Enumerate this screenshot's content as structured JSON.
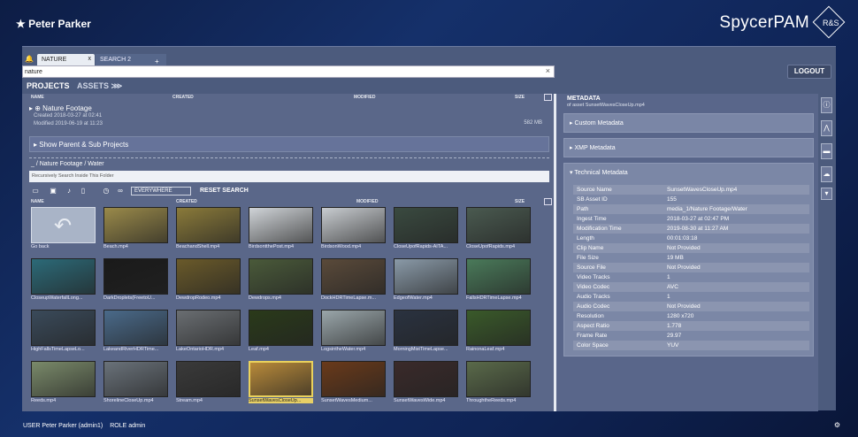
{
  "header": {
    "user_title": "★ Peter Parker",
    "brand": "SpycerPAM",
    "brand_logo": "R&S"
  },
  "tabs": [
    {
      "label": "NATURE",
      "close": "x"
    },
    {
      "label": "SEARCH 2",
      "close": "x"
    }
  ],
  "tab_add": "+",
  "search": {
    "value": "nature",
    "clear": "×"
  },
  "logout_label": "LOGOUT",
  "nav": {
    "projects": "PROJECTS",
    "assets": "ASSETS ⋙"
  },
  "columns": {
    "name": "NAME",
    "created": "CREATED",
    "modified": "MODIFIED",
    "size": "SIZE"
  },
  "project": {
    "name": "Nature Footage",
    "created": "Created  2018-03-27 at 02:41",
    "modified": "Modified  2019-06-19 at 11:23",
    "size": "582 MB"
  },
  "show_parent": "Show Parent & Sub Projects",
  "breadcrumb": "_ / Nature Footage  / Water",
  "recursive_placeholder": "Recursively Search Inside This Folder",
  "everywhere": "EVERYWHERE",
  "reset_search": "RESET SEARCH",
  "assets": [
    {
      "label": "Go back",
      "color": "#a9b4c7"
    },
    {
      "label": "Beach.mp4",
      "color": "#9a8a4a"
    },
    {
      "label": "BeachandShell.mp4",
      "color": "#8a7a3a"
    },
    {
      "label": "BirdsontthePost.mp4",
      "color": "#d0d4d8"
    },
    {
      "label": "BirdsonWood.mp4",
      "color": "#c8ccd0"
    },
    {
      "label": "CloseUpofRapids-AITA...",
      "color": "#3a4a40"
    },
    {
      "label": "CloseUpofRapids.mp4",
      "color": "#4a5a50"
    },
    {
      "label": "CloseupWaterfallLong...",
      "color": "#2c6a78"
    },
    {
      "label": "DarkDroplets(FreetoU...",
      "color": "#1a1a1a"
    },
    {
      "label": "DewdropRodeo.mp4",
      "color": "#6a5a2a"
    },
    {
      "label": "Dewdrops.mp4",
      "color": "#4a5a3a"
    },
    {
      "label": "DockHDRTimeLapse.m...",
      "color": "#5a4a3a"
    },
    {
      "label": "EdgeofWater.mp4",
      "color": "#8a9aa8"
    },
    {
      "label": "FallsHDRTimeLapse.mp4",
      "color": "#4a7a5a"
    },
    {
      "label": "HighFallsTimeLapseLo...",
      "color": "#3a4a5a"
    },
    {
      "label": "LakeandRiverHDRTime...",
      "color": "#4a6a8a"
    },
    {
      "label": "LakeOntarioHDR.mp4",
      "color": "#6a6e72"
    },
    {
      "label": "Leaf.mp4",
      "color": "#2a3a1a"
    },
    {
      "label": "LogsintheWater.mp4",
      "color": "#9aa6aa"
    },
    {
      "label": "MorningMistTimeLapse...",
      "color": "#2a3240"
    },
    {
      "label": "RainonaLeaf.mp4",
      "color": "#3a5a2a"
    },
    {
      "label": "Reeds.mp4",
      "color": "#7a8a6a"
    },
    {
      "label": "ShorelineCloseUp.mp4",
      "color": "#6a727a"
    },
    {
      "label": "Stream.mp4",
      "color": "#3a3a3a"
    },
    {
      "label": "SunsetWavesCloseUp...",
      "color": "#b88a3a"
    },
    {
      "label": "SunsetWavesMedium...",
      "color": "#6a3a1a"
    },
    {
      "label": "SunsetWavesWide.mp4",
      "color": "#3a2a2a"
    },
    {
      "label": "ThroughtheReeds.mp4",
      "color": "#5a6a4a"
    }
  ],
  "metadata": {
    "title": "METADATA",
    "subtitle": "of asset SunsetWavesCloseUp.mp4",
    "custom": "Custom Metadata",
    "xmp": "XMP Metadata",
    "technical": "Technical Metadata",
    "rows": [
      {
        "k": "Source Name",
        "v": "SunsetWavesCloseUp.mp4"
      },
      {
        "k": "SB Asset ID",
        "v": "155"
      },
      {
        "k": "Path",
        "v": "media_1/Nature Footage/Water"
      },
      {
        "k": "Ingest Time",
        "v": "2018-03-27 at 02:47 PM"
      },
      {
        "k": "Modification Time",
        "v": "2019-08-30 at 11:27 AM"
      },
      {
        "k": "Length",
        "v": "00:01:03:18"
      },
      {
        "k": "Clip Name",
        "v": "Not Provided"
      },
      {
        "k": "File Size",
        "v": "19 MB"
      },
      {
        "k": "Source File",
        "v": "Not Provided"
      },
      {
        "k": "Video Tracks",
        "v": "1"
      },
      {
        "k": "Video Codec",
        "v": "AVC"
      },
      {
        "k": "Audio Tracks",
        "v": "1"
      },
      {
        "k": "Audio Codec",
        "v": "Not Provided"
      },
      {
        "k": "Resolution",
        "v": "1280 x720"
      },
      {
        "k": "Aspect Ratio",
        "v": "1.778"
      },
      {
        "k": "Frame Rate",
        "v": "29.97"
      },
      {
        "k": "Color Space",
        "v": "YUV"
      }
    ]
  },
  "status": {
    "user": "USER Peter Parker (admin1)",
    "role": "ROLE admin"
  },
  "colors": {
    "accent": "#e8d066",
    "panel": "#5a6789"
  }
}
